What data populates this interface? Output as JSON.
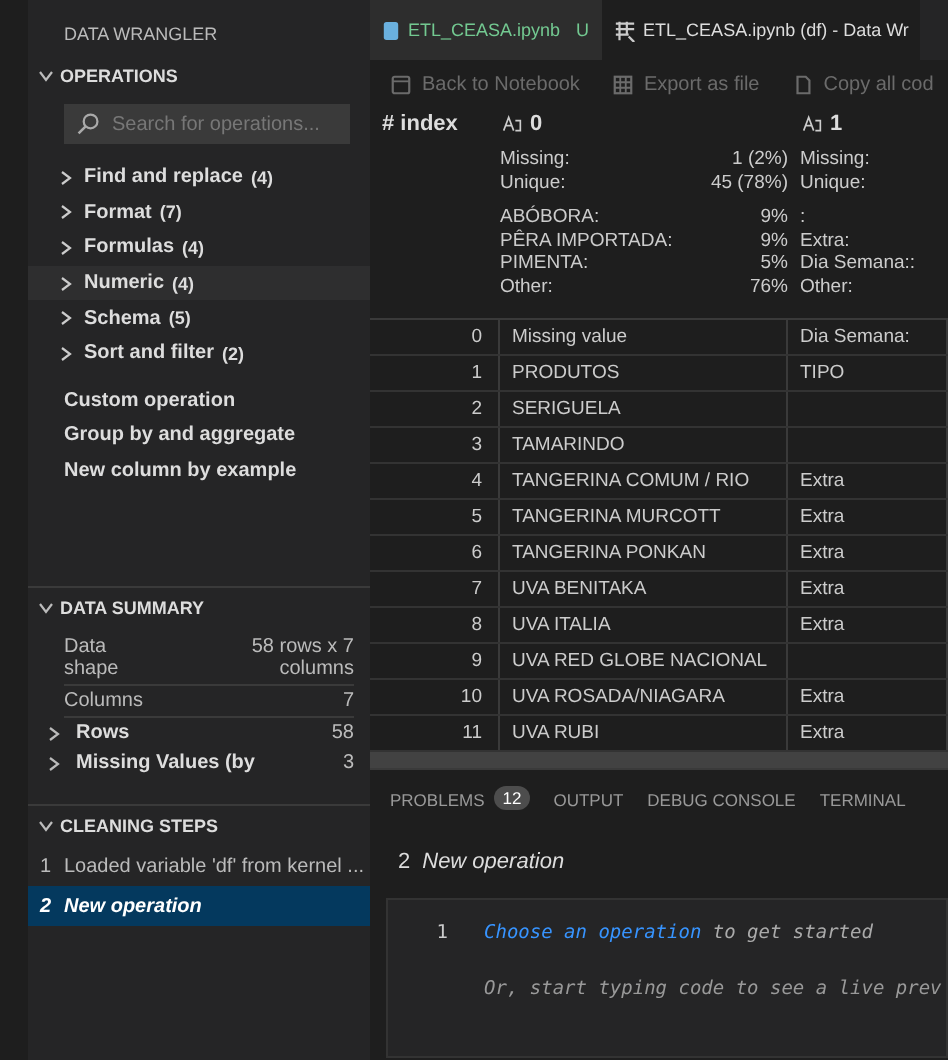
{
  "sidebar": {
    "title": "DATA WRANGLER",
    "operations": {
      "header": "OPERATIONS",
      "expanded": true,
      "search": {
        "placeholder": "Search for operations..."
      },
      "groups": [
        {
          "label": "Find and replace",
          "count": "(4)",
          "hovered": false
        },
        {
          "label": "Format",
          "count": "(7)",
          "hovered": false
        },
        {
          "label": "Formulas",
          "count": "(4)",
          "hovered": false
        },
        {
          "label": "Numeric",
          "count": "(4)",
          "hovered": true
        },
        {
          "label": "Schema",
          "count": "(5)",
          "hovered": false
        },
        {
          "label": "Sort and filter",
          "count": "(2)",
          "hovered": false
        }
      ],
      "actions": [
        "Custom operation",
        "Group by and aggregate",
        "New column by example"
      ]
    },
    "data_summary": {
      "header": "DATA SUMMARY",
      "expanded": true,
      "rows": [
        {
          "kind": "plain",
          "label": "Data shape",
          "value": "58 rows x 7 columns"
        },
        {
          "kind": "plain",
          "label": "Columns",
          "value": "7"
        },
        {
          "kind": "group",
          "label": "Rows",
          "value": "58"
        },
        {
          "kind": "group",
          "label": "Missing Values (by",
          "value": "3"
        }
      ]
    },
    "cleaning_steps": {
      "header": "CLEANING STEPS",
      "expanded": true,
      "steps": [
        {
          "number": "1",
          "label": "Loaded variable 'df' from kernel ...",
          "selected": false
        },
        {
          "number": "2",
          "label": "New operation",
          "selected": true
        }
      ]
    }
  },
  "tabs": [
    {
      "label": "ETL_CEASA.ipynb",
      "badge": "U",
      "selected": false
    },
    {
      "label": "ETL_CEASA.ipynb (df) - Data Wr",
      "selected": true
    }
  ],
  "toolbar": [
    {
      "label": "Back to Notebook",
      "kind": "notebook"
    },
    {
      "label": "Export as file",
      "kind": "table"
    },
    {
      "label": "Copy all cod",
      "kind": "copy"
    }
  ],
  "grid": {
    "index_mark": "#",
    "index_header": "index",
    "columns": [
      {
        "name": "0",
        "stats": [
          {
            "label": "Missing:",
            "value": "1 (2%)"
          },
          {
            "label": "Unique:",
            "value": "45 (78%)"
          }
        ],
        "top": [
          {
            "label": "ABÓBORA:",
            "value": "9%"
          },
          {
            "label": "PÊRA IMPORTADA:",
            "value": "9%"
          },
          {
            "label": "PIMENTA:",
            "value": "5%"
          },
          {
            "label": "Other:",
            "value": "76%"
          }
        ]
      },
      {
        "name": "1",
        "stats": [
          {
            "label": "Missing:"
          },
          {
            "label": "Unique:"
          }
        ],
        "top": [
          {
            "label": ":"
          },
          {
            "label": "Extra:"
          },
          {
            "label": "Dia Semana::"
          },
          {
            "label": "Other:"
          }
        ]
      }
    ],
    "rows": [
      {
        "index": "0",
        "cells": [
          "Missing value",
          "Dia Semana:"
        ]
      },
      {
        "index": "1",
        "cells": [
          "PRODUTOS",
          "TIPO"
        ]
      },
      {
        "index": "2",
        "cells": [
          "SERIGUELA",
          ""
        ]
      },
      {
        "index": "3",
        "cells": [
          "TAMARINDO",
          ""
        ]
      },
      {
        "index": "4",
        "cells": [
          "TANGERINA COMUM / RIO",
          "Extra"
        ]
      },
      {
        "index": "5",
        "cells": [
          "TANGERINA MURCOTT",
          "Extra"
        ]
      },
      {
        "index": "6",
        "cells": [
          "TANGERINA PONKAN",
          "Extra"
        ]
      },
      {
        "index": "7",
        "cells": [
          "UVA BENITAKA",
          "Extra"
        ]
      },
      {
        "index": "8",
        "cells": [
          "UVA ITALIA",
          "Extra"
        ]
      },
      {
        "index": "9",
        "cells": [
          "UVA RED GLOBE NACIONAL",
          ""
        ]
      },
      {
        "index": "10",
        "cells": [
          "UVA ROSADA/NIAGARA",
          "Extra"
        ]
      },
      {
        "index": "11",
        "cells": [
          "UVA RUBI",
          "Extra"
        ]
      }
    ]
  },
  "panel": {
    "tabs": [
      {
        "label": "PROBLEMS",
        "badge": "12"
      },
      {
        "label": "OUTPUT"
      },
      {
        "label": "DEBUG CONSOLE"
      },
      {
        "label": "TERMINAL"
      }
    ],
    "step_number": "2",
    "step_title": "New operation",
    "editor": {
      "line_number": "1",
      "link": "Choose an operation",
      "rest": " to get started",
      "hint": "Or, start typing code to see a live prev"
    }
  }
}
